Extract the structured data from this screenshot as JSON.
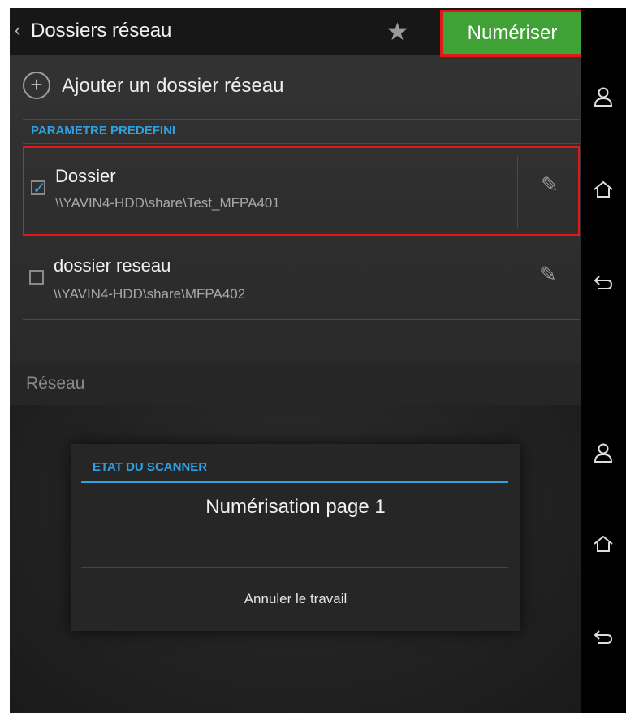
{
  "top": {
    "header": {
      "back_icon": "chevron-left-icon",
      "title": "Dossiers réseau",
      "favorite_icon": "star-icon",
      "scan_button": "Numériser",
      "scan_button_color": "#3fa136",
      "highlight_color": "#e01818"
    },
    "add_folder": {
      "icon": "plus-circle-icon",
      "label": "Ajouter un dossier réseau"
    },
    "section_title": "PARAMETRE PREDEFINI",
    "folders": [
      {
        "name": "Dossier",
        "path": "\\\\YAVIN4-HDD\\share\\Test_MFPA401",
        "checked": true,
        "edit_icon": "pencil-icon"
      },
      {
        "name": "dossier reseau",
        "path": "\\\\YAVIN4-HDD\\share\\MFPA402",
        "checked": false,
        "edit_icon": "pencil-icon"
      }
    ],
    "nav": [
      "user-icon",
      "home-icon",
      "back-arrow-icon"
    ]
  },
  "bottom": {
    "title": "Réseau",
    "dialog": {
      "heading": "ETAT DU SCANNER",
      "message": "Numérisation page 1",
      "cancel_button": "Annuler le travail"
    },
    "nav": [
      "user-icon",
      "home-icon",
      "back-arrow-icon"
    ]
  },
  "accent_color": "#2fa0e0"
}
